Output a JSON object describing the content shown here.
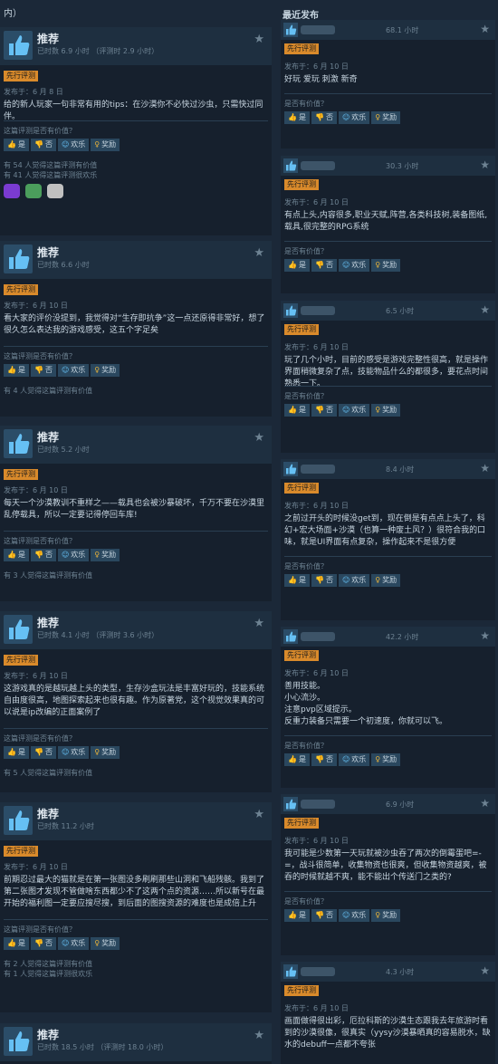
{
  "header": {
    "left_cut": "内）",
    "right_title": "最近发布"
  },
  "labels": {
    "early_access": "先行评测",
    "helpful_q": "这篇评测是否有价值？",
    "helpful_q_short": "是否有价值？",
    "yes": "是",
    "no": "否",
    "funny": "欢乐",
    "award": "奖励"
  },
  "left_reviews": [
    {
      "title": "推荐",
      "hours": "已时数 6.9 小时 （评测时 2.9 小时）",
      "posted": "发布于：6 月 8 日",
      "text": "给的新人玩家一句非常有用的tips：在沙漠你不必快过沙虫，只需快过同伴。",
      "stats": [
        "有 54 人觉得这篇评测有价值",
        "有 41 人觉得这篇评测很欢乐"
      ]
    },
    {
      "title": "推荐",
      "hours": "已时数 6.6 小时",
      "posted": "发布于：6 月 10 日",
      "text": "看大家的评价没提到，我觉得对“生存即抗争”这一点还原得非常好，想了很久怎么表达我的游戏感受，这五个字足矣",
      "stats": [
        "有 4 人觉得这篇评测有价值"
      ]
    },
    {
      "title": "推荐",
      "hours": "已时数 5.2 小时",
      "posted": "发布于：6 月 10 日",
      "text": "每天一个沙漠教训不重样之——载具也会被沙暴破坏，千万不要在沙漠里乱停载具，所以一定要记得停回车库!",
      "stats": [
        "有 3 人觉得这篇评测有价值"
      ]
    },
    {
      "title": "推荐",
      "hours": "已时数 4.1 小时 （评测时 3.6 小时）",
      "posted": "发布于：6 月 10 日",
      "text": "这游戏真的是越玩越上头的类型，生存沙盒玩法是丰富好玩的，技能系统自由度很高，地图探索起来也很有趣。作为原著党，这个视觉效果真的可以说是ip改编的正面案例了",
      "stats": [
        "有 5 人觉得这篇评测有价值"
      ]
    },
    {
      "title": "推荐",
      "hours": "已时数 11.2 小时",
      "posted": "发布于：6 月 10 日",
      "text": "前期忍过最大的猫就是在第一张图没多刷刷那些山洞和飞船残骸。我到了第二张图才发现不管做啥东西都少不了这两个点的资源……所以新号在最开始的福利图一定要应搜尽搜，到后面的图搜资源的难度也是成倍上升",
      "stats": [
        "有 2 人觉得这篇评测有价值",
        "有 1 人觉得这篇评测很欢乐"
      ]
    },
    {
      "title": "推荐",
      "hours": "已时数 18.5 小时 （评测时 18.0 小时）"
    }
  ],
  "right_reviews": [
    {
      "hours": "68.1 小时",
      "posted": "发布于：6 月 10 日",
      "text": "好玩 爱玩 刺激 新奇"
    },
    {
      "hours": "30.3 小时",
      "posted": "发布于：6 月 10 日",
      "text": "有点上头,内容很多,职业天赋,阵营,各类科技树,装备图纸,载具,很完整的RPG系统"
    },
    {
      "hours": "6.5 小时",
      "posted": "发布于：6 月 10 日",
      "text": "玩了几个小时，目前的感受是游戏完整性很高，就是操作界面稍微复杂了点，技能物品什么的都很多，要花点时间熟悉一下。"
    },
    {
      "hours": "8.4 小时",
      "posted": "发布于：6 月 10 日",
      "text": "之前过开头的时候没get到，现在倒是有点点上头了，科幻+宏大场面+沙漠（也算一种废土风？）很符合我的口味，就是UI界面有点复杂，操作起来不是很方便"
    },
    {
      "hours": "42.2 小时",
      "posted": "发布于：6 月 10 日",
      "text": "善用技能。\n小心流沙。\n注意pvp区域提示。\n反重力装备只需要一个初速度，你就可以飞。"
    },
    {
      "hours": "6.9 小时",
      "posted": "发布于：6 月 10 日",
      "text": "我可能是少数第一天玩就被沙虫吞了两次的倒霉蛋吧=-=，战斗很简单，收集物资也很爽，但收集物资越爽，被吞的时候就越不爽，能不能出个传送门之类的?"
    },
    {
      "hours": "4.3 小时",
      "posted": "发布于：6 月 10 日",
      "text": "画面做得很出彩，厄拉科斯的沙漠生态跟我去年旅游时看到的沙漠很像，很真实（yysy沙漠暴晒真的容易脱水，缺水的debuff一点都不夸张"
    }
  ]
}
